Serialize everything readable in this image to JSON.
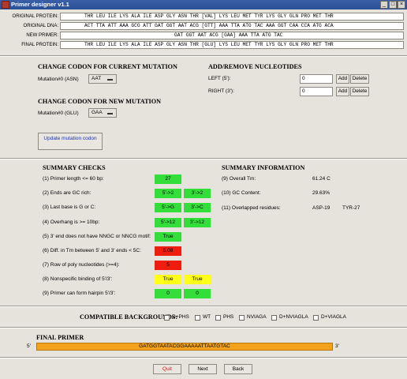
{
  "window": {
    "title": "Primer designer v1.1",
    "min": "_",
    "max": "□",
    "close": "×"
  },
  "sequences": [
    {
      "label": "ORIGINAL PROTEIN:",
      "value": "THR LEU ILE LYS ALA ILE ASP GLY ASN THR [VAL] LYS LEU MET TYR LYS GLY GLN PRO MET THR"
    },
    {
      "label": "ORIGINAL DNA:",
      "value": "ACT TTA ATT AAA GCG ATT GAT GGT AAT ACG [GTT] AAA TTA ATG TAC AAA GGT CAA CCA ATG ACA"
    },
    {
      "label": "NEW PRIMER:",
      "value": "GAT GGT AAT ACG [GAA] AAA TTA ATG TAC"
    },
    {
      "label": "FINAL PROTEIN:",
      "value": "THR LEU ILE LYS ALA ILE ASP GLY ASN THR [GLU] LYS LEU MET TYR LYS GLY GLN PRO MET THR"
    }
  ],
  "current_mutation": {
    "heading": "CHANGE CODON FOR CURRENT MUTATION",
    "label": "Mutation#0 (ASN)",
    "value": "AAT"
  },
  "new_mutation": {
    "heading": "CHANGE CODON FOR NEW MUTATION",
    "label": "Mutation#0 (GLU)",
    "value": "GAA"
  },
  "update_button": "Update mutation codon",
  "nucleotides": {
    "heading": "ADD/REMOVE NUCLEOTIDES",
    "rows": [
      {
        "label": "LEFT (5'):",
        "value": "0",
        "add": "Add",
        "delete": "Delete"
      },
      {
        "label": "RIGHT (3'):",
        "value": "0",
        "add": "Add",
        "delete": "Delete"
      }
    ]
  },
  "summary_checks": {
    "heading": "SUMMARY CHECKS",
    "rows": [
      {
        "label": "(1) Primer length <= 60 bp:",
        "cells": [
          {
            "text": "27",
            "color": "green"
          }
        ]
      },
      {
        "label": "(2) Ends are GC rich:",
        "cells": [
          {
            "text": "5'->2",
            "color": "green"
          },
          {
            "text": "3'->2",
            "color": "green"
          }
        ]
      },
      {
        "label": "(3) Last base is G or C:",
        "cells": [
          {
            "text": "5'->G",
            "color": "green"
          },
          {
            "text": "3'->C",
            "color": "green"
          }
        ]
      },
      {
        "label": "(4) Overhang is >= 10bp:",
        "cells": [
          {
            "text": "5'->12",
            "color": "green"
          },
          {
            "text": "3'->12",
            "color": "green"
          }
        ]
      },
      {
        "label": "(5) 3' end does not have NNGC or NNCG motif:",
        "cells": [
          {
            "text": "True",
            "color": "green"
          }
        ]
      },
      {
        "label": "(6) Diff. in Tm between 5' and 3' ends < 5C:",
        "cells": [
          {
            "text": "5.08",
            "color": "red"
          }
        ]
      },
      {
        "label": "(7) Row of poly nucleotides (>=4):",
        "cells": [
          {
            "text": "5",
            "color": "red"
          }
        ]
      },
      {
        "label": "(8) Nonspecific binding of 5'/3':",
        "cells": [
          {
            "text": "True",
            "color": "yellow"
          },
          {
            "text": "True",
            "color": "yellow"
          }
        ]
      },
      {
        "label": "(9) Primer can form hairpin 5'/3':",
        "cells": [
          {
            "text": "0",
            "color": "green"
          },
          {
            "text": "0",
            "color": "green"
          }
        ]
      }
    ]
  },
  "summary_info": {
    "heading": "SUMMARY INFORMATION",
    "rows": [
      {
        "label": "(9) Overall Tm:",
        "value": "61.24 C",
        "extra": ""
      },
      {
        "label": "(10) GC Content:",
        "value": "29.63%",
        "extra": ""
      },
      {
        "label": "(11) Overlapped residues:",
        "value": "ASP-19",
        "extra": "TYR-27"
      }
    ]
  },
  "backgrounds": {
    "heading": "COMPATIBLE BACKGROUNDS:",
    "items": [
      "D+PHS",
      "WT",
      "PHS",
      "NVIAGA",
      "D+NVIAGLA",
      "D+VIAGLA"
    ]
  },
  "final_primer": {
    "heading": "FINAL PRIMER",
    "left": "5'",
    "right": "3'",
    "sequence": "GATGGTAATACGGAAAAATTAATGTAC"
  },
  "nav": {
    "quit": "Quit",
    "next": "Next",
    "back": "Back"
  },
  "colors": {
    "green": "#33dd3a",
    "red": "#ee1d0d",
    "yellow": "#ffff1a",
    "primer": "#f2a31b",
    "titlebar": "#2b4f95"
  }
}
